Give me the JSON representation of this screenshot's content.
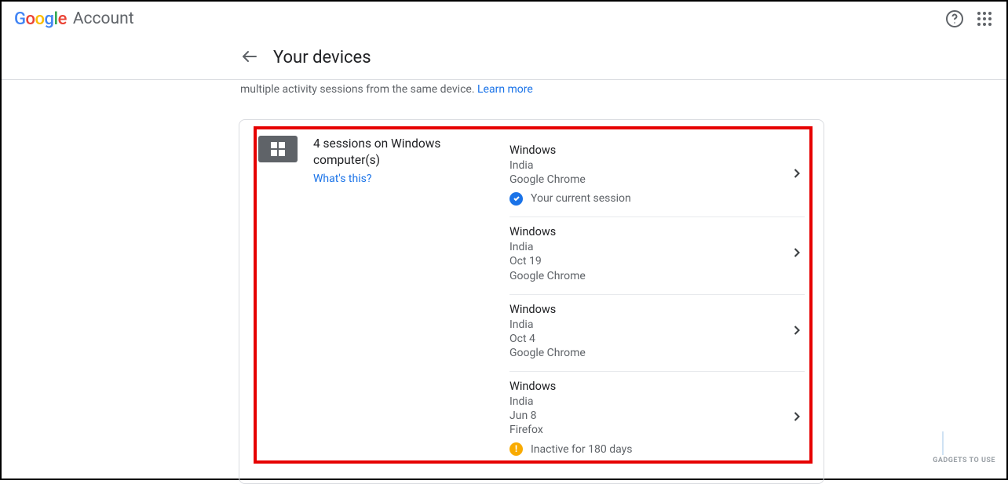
{
  "header": {
    "product": "Account"
  },
  "subheader": {
    "title": "Your devices"
  },
  "description": {
    "text": "multiple activity sessions from the same device. ",
    "learn_more": "Learn more"
  },
  "card": {
    "sessions_title_line1": "4 sessions on Windows",
    "sessions_title_line2": "computer(s)",
    "whats_this": "What's this?",
    "sessions": [
      {
        "os": "Windows",
        "location": "India",
        "date": "",
        "browser": "Google Chrome",
        "status": "Your current session",
        "status_type": "current"
      },
      {
        "os": "Windows",
        "location": "India",
        "date": "Oct 19",
        "browser": "Google Chrome",
        "status": "",
        "status_type": ""
      },
      {
        "os": "Windows",
        "location": "India",
        "date": "Oct 4",
        "browser": "Google Chrome",
        "status": "",
        "status_type": ""
      },
      {
        "os": "Windows",
        "location": "India",
        "date": "Jun 8",
        "browser": "Firefox",
        "status": "Inactive for 180 days",
        "status_type": "inactive"
      }
    ]
  },
  "watermark": "GADGETS TO USE"
}
